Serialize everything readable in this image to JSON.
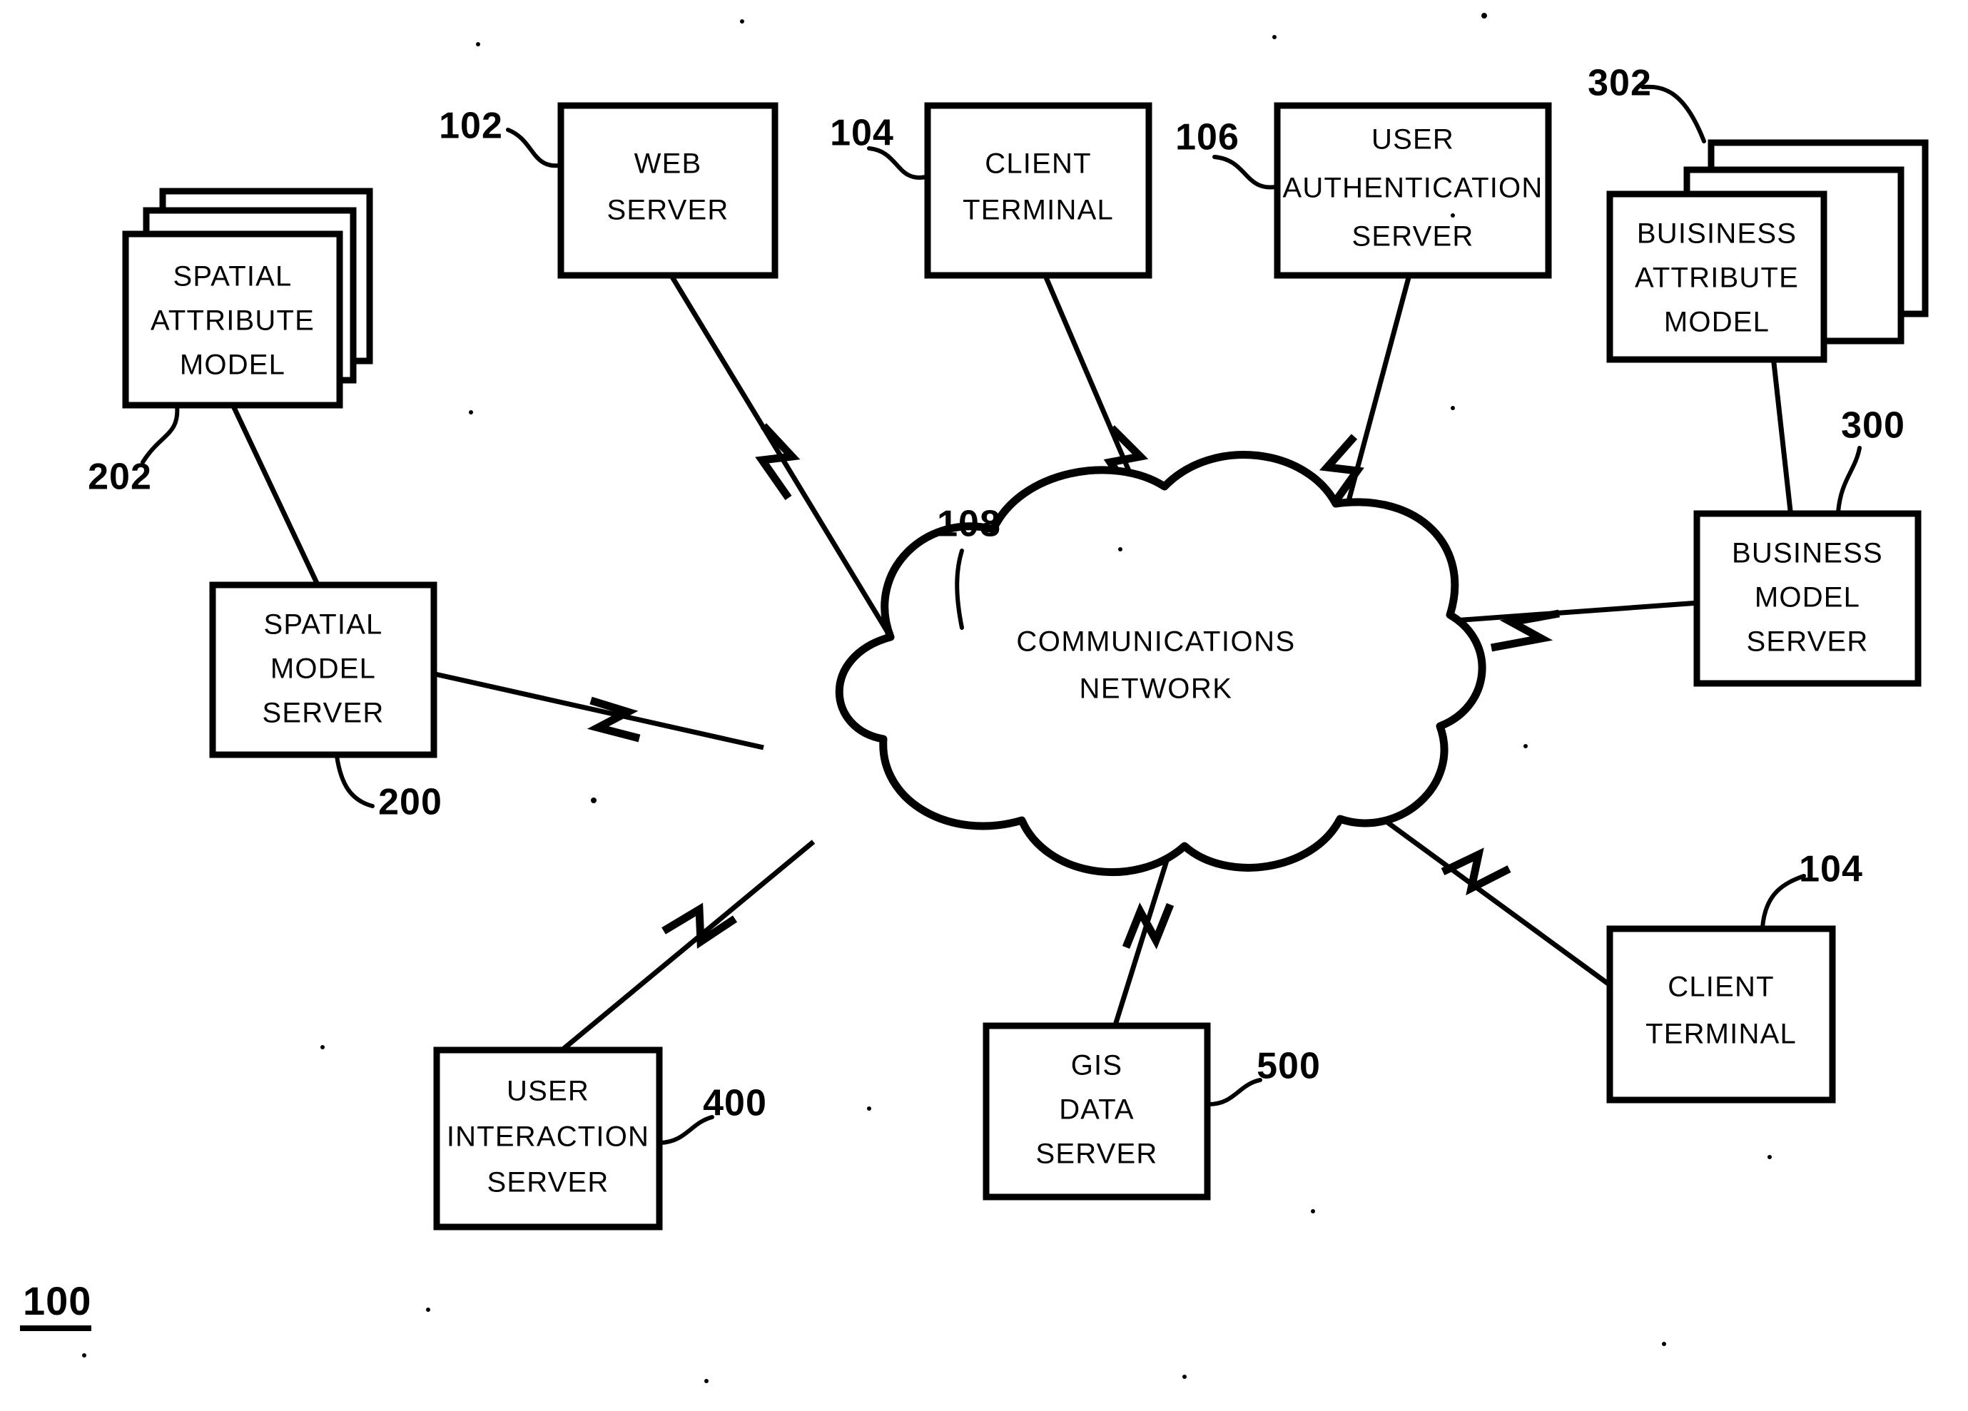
{
  "figure": {
    "number": "100",
    "underlined": true
  },
  "nodes": [
    {
      "id": "spatial-attribute-model",
      "ref": "202",
      "kind": "stack",
      "lines": [
        "SPATIAL",
        "ATTRIBUTE",
        "MODEL"
      ]
    },
    {
      "id": "web-server",
      "ref": "102",
      "kind": "box",
      "lines": [
        "WEB",
        "SERVER"
      ]
    },
    {
      "id": "client-terminal-top",
      "ref": "104",
      "kind": "box",
      "lines": [
        "CLIENT",
        "TERMINAL"
      ]
    },
    {
      "id": "user-authentication-server",
      "ref": "106",
      "kind": "box",
      "lines": [
        "USER",
        "AUTHENTICATION",
        "SERVER"
      ]
    },
    {
      "id": "buisiness-attribute-model",
      "ref": "302",
      "kind": "stack",
      "lines": [
        "BUISINESS",
        "ATTRIBUTE",
        "MODEL"
      ]
    },
    {
      "id": "business-model-server",
      "ref": "300",
      "kind": "box",
      "lines": [
        "BUSINESS",
        "MODEL",
        "SERVER"
      ]
    },
    {
      "id": "spatial-model-server",
      "ref": "200",
      "kind": "box",
      "lines": [
        "SPATIAL",
        "MODEL",
        "SERVER"
      ]
    },
    {
      "id": "communications-network",
      "ref": "108",
      "kind": "cloud",
      "lines": [
        "COMMUNICATIONS",
        "NETWORK"
      ]
    },
    {
      "id": "user-interaction-server",
      "ref": "400",
      "kind": "box",
      "lines": [
        "USER",
        "INTERACTION",
        "SERVER"
      ]
    },
    {
      "id": "gis-data-server",
      "ref": "500",
      "kind": "box",
      "lines": [
        "GIS",
        "DATA",
        "SERVER"
      ]
    },
    {
      "id": "client-terminal-bottom",
      "ref": "104",
      "kind": "box",
      "lines": [
        "CLIENT",
        "TERMINAL"
      ]
    }
  ],
  "labels": {
    "spatial_attribute_model_l1": "SPATIAL",
    "spatial_attribute_model_l2": "ATTRIBUTE",
    "spatial_attribute_model_l3": "MODEL",
    "web_server_l1": "WEB",
    "web_server_l2": "SERVER",
    "client_terminal_top_l1": "CLIENT",
    "client_terminal_top_l2": "TERMINAL",
    "user_auth_server_l1": "USER",
    "user_auth_server_l2": "AUTHENTICATION",
    "user_auth_server_l3": "SERVER",
    "buisiness_attribute_model_l1": "BUISINESS",
    "buisiness_attribute_model_l2": "ATTRIBUTE",
    "buisiness_attribute_model_l3": "MODEL",
    "business_model_server_l1": "BUSINESS",
    "business_model_server_l2": "MODEL",
    "business_model_server_l3": "SERVER",
    "spatial_model_server_l1": "SPATIAL",
    "spatial_model_server_l2": "MODEL",
    "spatial_model_server_l3": "SERVER",
    "communications_network_l1": "COMMUNICATIONS",
    "communications_network_l2": "NETWORK",
    "user_interaction_server_l1": "USER",
    "user_interaction_server_l2": "INTERACTION",
    "user_interaction_server_l3": "SERVER",
    "gis_data_server_l1": "GIS",
    "gis_data_server_l2": "DATA",
    "gis_data_server_l3": "SERVER",
    "client_terminal_bottom_l1": "CLIENT",
    "client_terminal_bottom_l2": "TERMINAL"
  },
  "reference_numerals": {
    "fig": "100",
    "web_server": "102",
    "client_terminal_top": "104",
    "user_auth_server": "106",
    "communications_network": "108",
    "spatial_model_server": "200",
    "spatial_attribute_model": "202",
    "business_model_server": "300",
    "buisiness_attribute_model": "302",
    "user_interaction_server": "400",
    "gis_data_server": "500",
    "client_terminal_bottom": "104"
  },
  "style": {
    "ink": "#000000",
    "paper": "#ffffff"
  }
}
